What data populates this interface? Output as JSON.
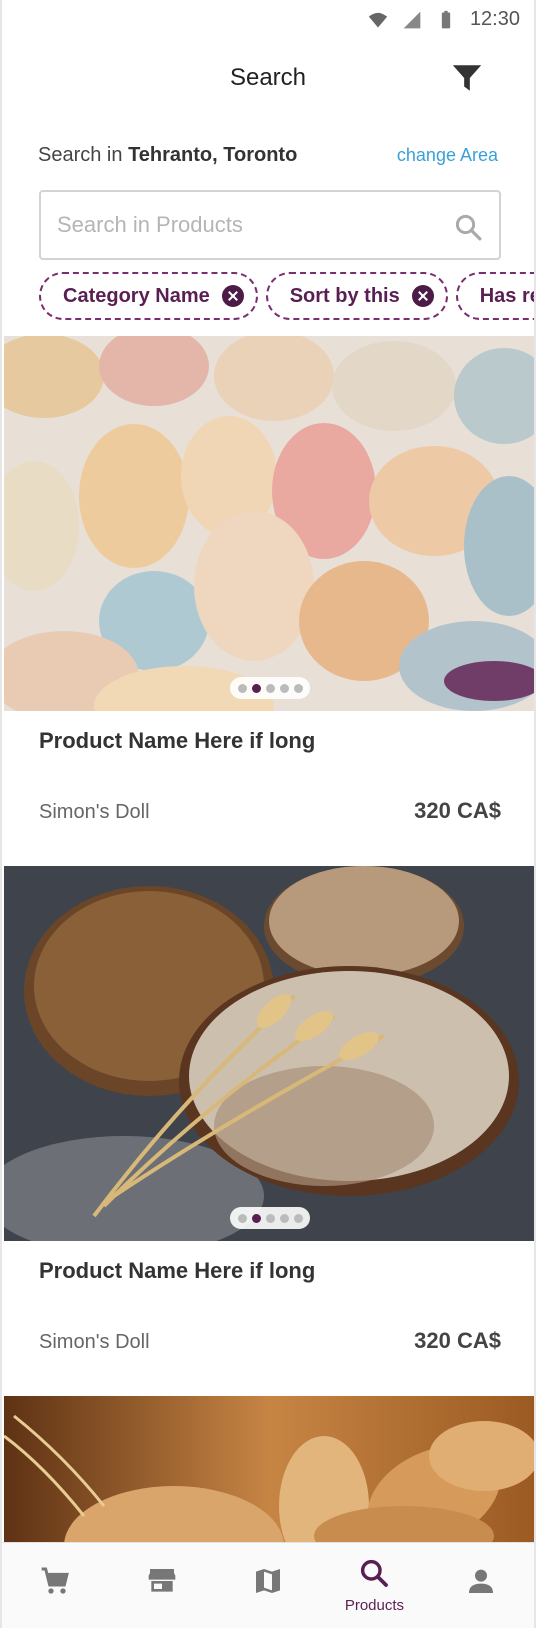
{
  "status_bar": {
    "time": "12:30"
  },
  "header": {
    "title": "Search"
  },
  "area": {
    "prefix": "Search in",
    "location": "Tehranto, Toronto",
    "change_label": "change Area"
  },
  "search": {
    "placeholder": "Search in Products",
    "value": ""
  },
  "chips": [
    {
      "label": "Category Name",
      "removable": true
    },
    {
      "label": "Sort by this",
      "removable": true
    },
    {
      "label": "Has return",
      "removable": false
    }
  ],
  "products": [
    {
      "name": "Product Name Here if long",
      "seller": "Simon's Doll",
      "price": "320 CA$",
      "image": "macarons-image",
      "carousel": {
        "count": 5,
        "active_index": 1
      }
    },
    {
      "name": "Product Name Here if long",
      "seller": "Simon's Doll",
      "price": "320 CA$",
      "image": "bread-wheat-image",
      "carousel": {
        "count": 5,
        "active_index": 1
      }
    },
    {
      "image": "bread-basket-image"
    }
  ],
  "bottom_nav": {
    "items": [
      {
        "icon": "cart-icon",
        "label": ""
      },
      {
        "icon": "store-icon",
        "label": ""
      },
      {
        "icon": "map-icon",
        "label": ""
      },
      {
        "icon": "search-icon",
        "label": "Products",
        "active": true
      },
      {
        "icon": "person-icon",
        "label": ""
      }
    ]
  },
  "colors": {
    "accent": "#5a1f52",
    "link": "#3aa0d8",
    "chip_border": "#7a2e6f"
  }
}
